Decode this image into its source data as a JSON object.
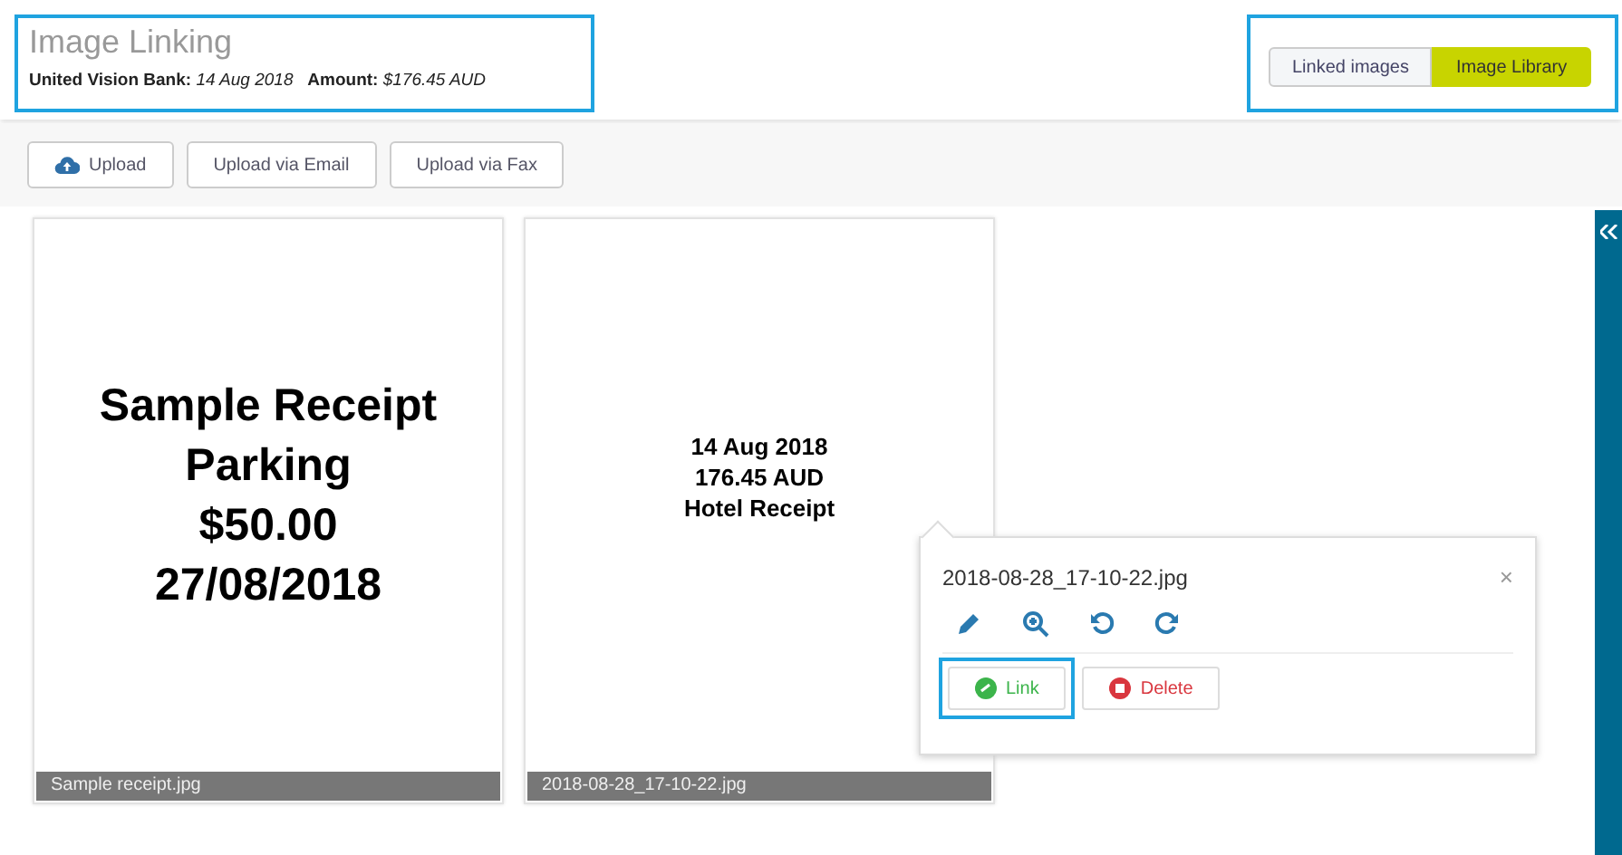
{
  "header": {
    "title": "Image Linking",
    "bank_label": "United Vision Bank:",
    "date": "14 Aug 2018",
    "amount_label": "Amount:",
    "amount": "$176.45 AUD"
  },
  "view_toggle": [
    {
      "label": "Linked images",
      "selected": false
    },
    {
      "label": "Image Library",
      "selected": true
    }
  ],
  "toolbar": [
    {
      "label": "Upload",
      "kind": "upload"
    },
    {
      "label": "Upload via Email",
      "kind": "plain"
    },
    {
      "label": "Upload via Fax",
      "kind": "plain"
    }
  ],
  "images": [
    {
      "lines": [
        "Sample Receipt",
        "Parking",
        "$50.00",
        "27/08/2018"
      ],
      "kind": "large",
      "caption": "Sample receipt.jpg"
    },
    {
      "lines": [
        "14 Aug 2018",
        "176.45 AUD",
        "Hotel Receipt"
      ],
      "kind": "small",
      "caption": "2018-08-28_17-10-22.jpg"
    }
  ],
  "popover": {
    "title": "2018-08-28_17-10-22.jpg",
    "close": "×",
    "actions": [
      {
        "kind": "edit"
      },
      {
        "kind": "zoom"
      },
      {
        "kind": "rotate_left"
      },
      {
        "kind": "rotate_right"
      }
    ],
    "link": "Link",
    "delete": "Delete"
  }
}
